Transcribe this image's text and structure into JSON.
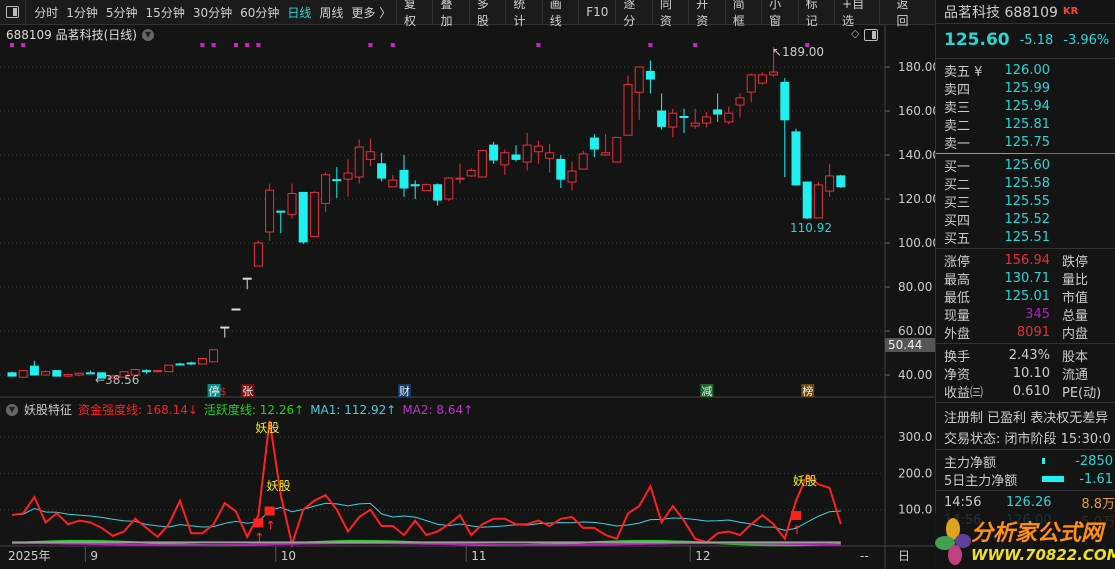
{
  "toolbar": {
    "periods": [
      "分时",
      "1分钟",
      "5分钟",
      "15分钟",
      "30分钟",
      "60分钟",
      "日线",
      "周线",
      "更多 〉"
    ],
    "active_period": "日线",
    "buttons": [
      "复权",
      "叠加",
      "多股",
      "统计",
      "画线",
      "F10",
      "逐分",
      "同资",
      "开资",
      "简框",
      "小窗",
      "标记",
      "+自选"
    ],
    "back": "返回"
  },
  "chart_title": "688109 品茗科技(日线)",
  "price_axis": [
    "180.00",
    "160.00",
    "140.00",
    "120.00",
    "100.00",
    "80.00",
    "60.00",
    "40.00"
  ],
  "cursor_value": "50.44",
  "annotations": {
    "high": "189.00",
    "low": "110.92",
    "min_left": "←38.56"
  },
  "events": [
    {
      "label": "停",
      "color": "#138a8a",
      "i": 18
    },
    {
      "label": "$",
      "color": "#e02020",
      "i": 19,
      "text_only": true
    },
    {
      "label": "张",
      "color": "#7a1010",
      "i": 21
    },
    {
      "label": "财",
      "color": "#123a6a",
      "i": 35
    },
    {
      "label": "减",
      "color": "#1a6a2a",
      "i": 62
    },
    {
      "label": "榜",
      "color": "#6a4a10",
      "i": 71
    }
  ],
  "marker_indices": [
    0,
    1,
    17,
    18,
    20,
    21,
    22,
    32,
    34,
    47,
    57,
    61,
    71
  ],
  "indicator": {
    "name": "妖股特征",
    "line1": "资金强度线: 168.14↓",
    "line2": "活跃度线: 12.26↑",
    "ma1": "MA1: 112.92↑",
    "ma2": "MA2: 8.64↑",
    "axis": [
      "300.0",
      "200.0",
      "100.0"
    ],
    "tag": "妖股",
    "signal_indices": [
      22,
      23,
      70
    ],
    "tag_indices": [
      22,
      23,
      70
    ]
  },
  "time_axis": [
    {
      "label": "2025年",
      "i": 0
    },
    {
      "label": "9",
      "i": 7
    },
    {
      "label": "10",
      "i": 24
    },
    {
      "label": "11",
      "i": 41
    },
    {
      "label": "12",
      "i": 61
    }
  ],
  "time_axis_end": "--",
  "period_mark": "日",
  "colors": {
    "up": "#e8303a",
    "down": "#1ff0f0",
    "bg": "#141414",
    "accent": "#27d7d7",
    "strength": "#ff2020",
    "ma1": "#40d0e0",
    "active": "#20d020",
    "ma2": "#b020b0"
  },
  "chart_data": {
    "type": "candlestick",
    "ylim": [
      30,
      195
    ],
    "ohlc": [
      [
        41,
        41.5,
        39.5,
        39.5
      ],
      [
        39,
        42,
        39,
        42
      ],
      [
        44,
        46.5,
        40,
        40
      ],
      [
        40,
        42,
        40,
        41.5
      ],
      [
        42,
        42,
        39.5,
        39.5
      ],
      [
        39.5,
        40.5,
        39,
        40.2
      ],
      [
        40,
        41,
        39.5,
        40.8
      ],
      [
        41,
        42,
        40.5,
        40.8
      ],
      [
        41,
        41,
        38.56,
        38.6
      ],
      [
        38.6,
        40,
        38.6,
        39.5
      ],
      [
        39,
        41.5,
        39,
        41.5
      ],
      [
        40,
        42.5,
        40,
        42.5
      ],
      [
        42,
        42.5,
        40.5,
        41.5
      ],
      [
        41.5,
        42.2,
        41.5,
        42
      ],
      [
        41.5,
        44.5,
        41.5,
        44.5
      ],
      [
        45,
        45.5,
        44.5,
        45
      ],
      [
        45.5,
        46,
        44.5,
        45.5
      ],
      [
        45,
        47.5,
        45,
        47.5
      ],
      [
        46,
        51.5,
        46,
        51.5
      ],
      [
        61.8,
        61.8,
        57,
        61.8
      ],
      [
        70,
        70,
        70,
        70
      ],
      [
        84,
        84,
        79,
        84
      ],
      [
        89.5,
        101,
        89.5,
        100
      ],
      [
        105,
        127,
        101,
        124
      ],
      [
        114.5,
        114.5,
        104.5,
        114
      ],
      [
        113,
        127,
        111,
        122.5
      ],
      [
        123,
        123,
        99.5,
        100.5
      ],
      [
        103,
        123.5,
        103,
        123
      ],
      [
        118,
        132,
        114,
        131
      ],
      [
        128.8,
        134.5,
        120.5,
        128.5
      ],
      [
        129,
        138,
        121,
        131.8
      ],
      [
        130,
        147,
        127,
        143.6
      ],
      [
        138,
        147.5,
        135,
        141.5
      ],
      [
        136,
        141,
        128,
        129.5
      ],
      [
        125.5,
        131,
        125.5,
        128.6
      ],
      [
        133,
        140,
        121,
        125
      ],
      [
        126.5,
        128.5,
        120,
        126
      ],
      [
        123.8,
        127,
        123.8,
        126.5
      ],
      [
        126.5,
        127,
        117,
        119.5
      ],
      [
        120,
        130,
        119,
        129.5
      ],
      [
        129,
        136,
        127,
        129.5
      ],
      [
        130.5,
        134,
        130,
        133
      ],
      [
        130,
        142,
        130,
        142
      ],
      [
        144.5,
        146,
        136,
        137.7
      ],
      [
        135.5,
        142.5,
        131,
        141
      ],
      [
        140,
        144.5,
        137,
        138
      ],
      [
        136.8,
        150,
        133,
        144.5
      ],
      [
        141.5,
        146.5,
        136,
        144
      ],
      [
        138.5,
        145,
        132,
        141
      ],
      [
        138,
        140,
        125,
        129
      ],
      [
        127.7,
        137,
        124,
        132.7
      ],
      [
        133.6,
        142,
        133.6,
        140.5
      ],
      [
        147.7,
        149.5,
        139,
        142.7
      ],
      [
        140,
        149.5,
        139.5,
        141
      ],
      [
        136.8,
        148,
        136.8,
        148
      ],
      [
        149,
        176,
        149,
        172
      ],
      [
        168.5,
        180,
        156,
        180
      ],
      [
        178,
        183,
        168,
        174.5
      ],
      [
        160,
        168,
        151.5,
        153
      ],
      [
        152.7,
        161,
        148,
        159
      ],
      [
        157.5,
        161,
        150,
        157.3
      ],
      [
        153.2,
        161,
        152,
        154.5
      ],
      [
        154.5,
        159.5,
        152.5,
        157.3
      ],
      [
        160.5,
        168,
        155,
        158.6
      ],
      [
        155,
        162,
        154,
        159
      ],
      [
        162.7,
        168,
        157,
        166
      ],
      [
        168.6,
        177,
        164,
        176.4
      ],
      [
        172.7,
        177.5,
        172,
        176.4
      ],
      [
        176.4,
        189,
        175.5,
        177.7
      ],
      [
        173,
        175,
        130,
        156
      ],
      [
        150.5,
        152,
        126,
        126.4
      ],
      [
        127.7,
        127.7,
        110.92,
        111.4
      ],
      [
        111.4,
        127.7,
        111.4,
        126.4
      ],
      [
        123.6,
        136,
        121,
        130.5
      ],
      [
        130.5,
        131,
        125.01,
        125.6
      ]
    ],
    "strength": [
      85,
      90,
      135,
      65,
      90,
      60,
      70,
      65,
      50,
      28,
      40,
      75,
      50,
      25,
      60,
      125,
      35,
      35,
      60,
      118,
      95,
      25,
      85,
      345,
      140,
      5,
      100,
      125,
      140,
      100,
      40,
      80,
      100,
      55,
      55,
      30,
      70,
      30,
      40,
      60,
      85,
      30,
      60,
      75,
      75,
      60,
      60,
      70,
      55,
      75,
      80,
      50,
      50,
      30,
      20,
      90,
      110,
      165,
      65,
      110,
      70,
      20,
      10,
      35,
      40,
      30,
      60,
      85,
      60,
      20,
      125,
      195,
      170,
      160,
      60
    ],
    "ind_ylim": [
      0,
      340
    ]
  },
  "quote": {
    "name_code": "品茗科技 688109",
    "tag": "KR",
    "price": "125.60",
    "change": "-5.18",
    "pct": "-3.96%",
    "asks": [
      {
        "l": "卖五 ¥",
        "v": "126.00"
      },
      {
        "l": "卖四",
        "v": "125.99"
      },
      {
        "l": "卖三",
        "v": "125.94"
      },
      {
        "l": "卖二",
        "v": "125.81"
      },
      {
        "l": "卖一",
        "v": "125.75"
      }
    ],
    "bids": [
      {
        "l": "买一",
        "v": "125.60"
      },
      {
        "l": "买二",
        "v": "125.58"
      },
      {
        "l": "买三",
        "v": "125.55"
      },
      {
        "l": "买四",
        "v": "125.52"
      },
      {
        "l": "买五",
        "v": "125.51"
      }
    ],
    "stats": [
      {
        "l": "涨停",
        "v": "156.94",
        "c": "#e8303a",
        "r": "跌停"
      },
      {
        "l": "最高",
        "v": "130.71",
        "c": "#27d7d7",
        "r": "量比"
      },
      {
        "l": "最低",
        "v": "125.01",
        "c": "#27d7d7",
        "r": "市值"
      },
      {
        "l": "现量",
        "v": "345",
        "c": "#b020c0",
        "r": "总量"
      },
      {
        "l": "外盘",
        "v": "8091",
        "c": "#e8303a",
        "r": "内盘"
      }
    ],
    "stats2": [
      {
        "l": "换手",
        "v": "2.43%",
        "r": "股本"
      },
      {
        "l": "净资",
        "v": "10.10",
        "r": "流通"
      },
      {
        "l": "收益㈢",
        "v": "0.610",
        "r": "PE(动)"
      }
    ],
    "tags": "注册制 已盈利 表决权无差异",
    "status": "交易状态: 闭市阶段 15:30:0",
    "flow": [
      {
        "l": "主力净额",
        "v": "-2850"
      },
      {
        "l": "5日主力净额",
        "v": "-1.61"
      }
    ],
    "ticks": [
      {
        "t": "14:56",
        "p": "126.26",
        "q": "8.8万"
      },
      {
        "t": "14:56",
        "p": "126.00",
        "q": "5.0万"
      }
    ]
  },
  "watermark": {
    "title": "分析家公式网",
    "url": "WWW.70822.COM"
  }
}
